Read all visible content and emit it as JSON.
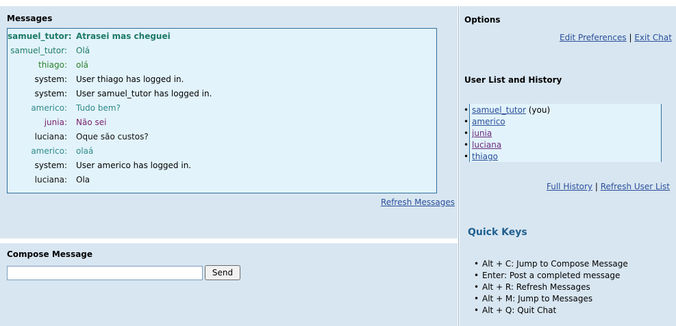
{
  "messages_panel": {
    "title": "Messages",
    "refresh_label": "Refresh Messages",
    "rows": [
      {
        "name": "samuel_tutor:",
        "text": "Atrasei mas cheguei",
        "color": "#1d7a66",
        "bold": true
      },
      {
        "name": "samuel_tutor:",
        "text": "Olá",
        "color": "#1d7a66",
        "bold": false
      },
      {
        "name": "thiago:",
        "text": "olá",
        "color": "#2b7f2b",
        "bold": false
      },
      {
        "name": "system:",
        "text": "User thiago has logged in.",
        "color": "#000000",
        "bold": false
      },
      {
        "name": "system:",
        "text": "User samuel_tutor has logged in.",
        "color": "#000000",
        "bold": false
      },
      {
        "name": "americo:",
        "text": "Tudo bem?",
        "color": "#2f8a8a",
        "bold": false
      },
      {
        "name": "junia:",
        "text": "Não sei",
        "color": "#7a1f6b",
        "bold": false
      },
      {
        "name": "luciana:",
        "text": "Oque são custos?",
        "color": "#111111",
        "bold": false
      },
      {
        "name": "americo:",
        "text": "olaá",
        "color": "#2f8a8a",
        "bold": false
      },
      {
        "name": "system:",
        "text": "User americo has logged in.",
        "color": "#000000",
        "bold": false
      },
      {
        "name": "luciana:",
        "text": "Ola",
        "color": "#111111",
        "bold": false
      }
    ]
  },
  "compose_panel": {
    "title": "Compose Message",
    "input_value": "",
    "send_label": "Send"
  },
  "options_panel": {
    "title": "Options",
    "edit_preferences": "Edit Preferences",
    "separator": "|",
    "exit_chat": "Exit Chat"
  },
  "user_list_panel": {
    "title": "User List and History",
    "users": [
      {
        "name": "samuel_tutor",
        "suffix": " (you)",
        "visited": false
      },
      {
        "name": "americo",
        "suffix": "",
        "visited": false
      },
      {
        "name": "junia",
        "suffix": "",
        "visited": true
      },
      {
        "name": "luciana",
        "suffix": "",
        "visited": true
      },
      {
        "name": "thiago",
        "suffix": "",
        "visited": false
      }
    ],
    "full_history": "Full History",
    "separator": "|",
    "refresh_user_list": "Refresh User List"
  },
  "quick_keys_panel": {
    "title": "Quick Keys",
    "items": [
      "Alt + C: Jump to Compose Message",
      "Enter: Post a completed message",
      "Alt + R: Refresh Messages",
      "Alt + M: Jump to Messages",
      "Alt + Q: Quit Chat"
    ]
  },
  "colors": {
    "panel_background": "#d8e6f1",
    "message_box_background": "#e2f3fb",
    "border": "#2c6e9a",
    "link": "#2a4f9a",
    "link_visited": "#6b2a7f",
    "quick_keys_title": "#1f5f8f"
  }
}
